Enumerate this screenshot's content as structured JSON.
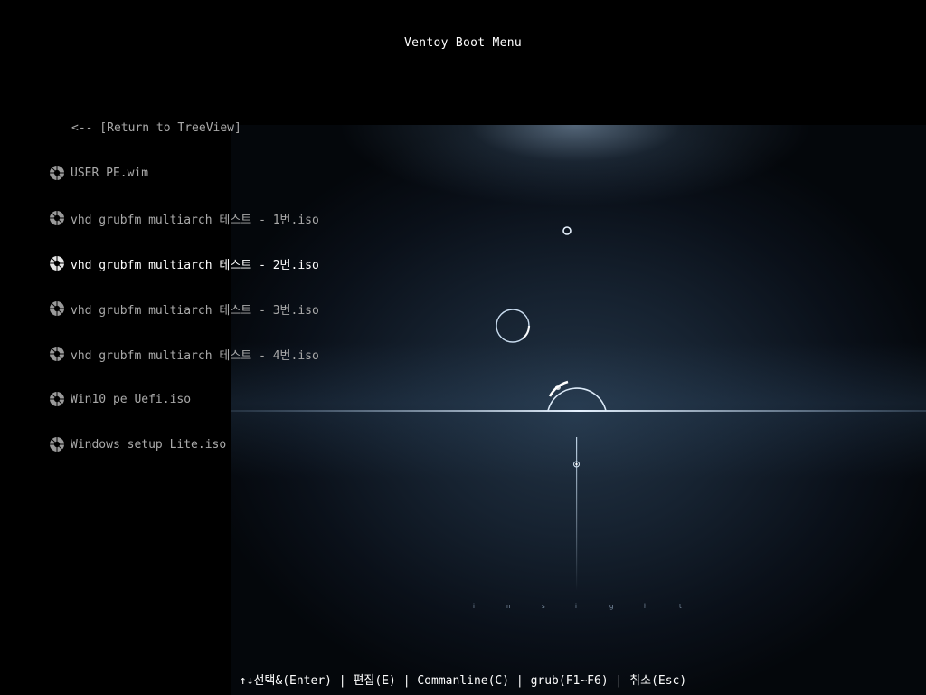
{
  "window": {
    "title": "Ventoy Boot Menu"
  },
  "menu": {
    "return_label": "<-- [Return to TreeView]",
    "items": [
      {
        "label": "USER PE.wim",
        "icon": "disc-icon",
        "selected": false
      },
      {
        "label": "vhd grubfm multiarch 테스트 - 1번.iso",
        "icon": "disc-icon",
        "selected": false
      },
      {
        "label": "vhd grubfm multiarch 테스트 - 2번.iso",
        "icon": "disc-icon",
        "selected": true
      },
      {
        "label": "vhd grubfm multiarch 테스트 - 3번.iso",
        "icon": "disc-icon",
        "selected": false
      },
      {
        "label": "vhd grubfm multiarch 테스트 - 4번.iso",
        "icon": "disc-icon",
        "selected": false
      },
      {
        "label": "Win10 pe Uefi.iso",
        "icon": "disc-icon",
        "selected": false
      },
      {
        "label": "Windows setup Lite.iso",
        "icon": "disc-icon",
        "selected": false
      }
    ]
  },
  "footer": {
    "hint": "↑↓선택&(Enter) | 편집(E) | Commanline(C) | grub(F1~F6) | 취소(Esc)"
  },
  "background": {
    "wordmark": "i n s i g h t",
    "colors": {
      "text_normal": "#a9a9a9",
      "text_selected": "#ffffff",
      "glow": "#bcd6ee"
    }
  }
}
